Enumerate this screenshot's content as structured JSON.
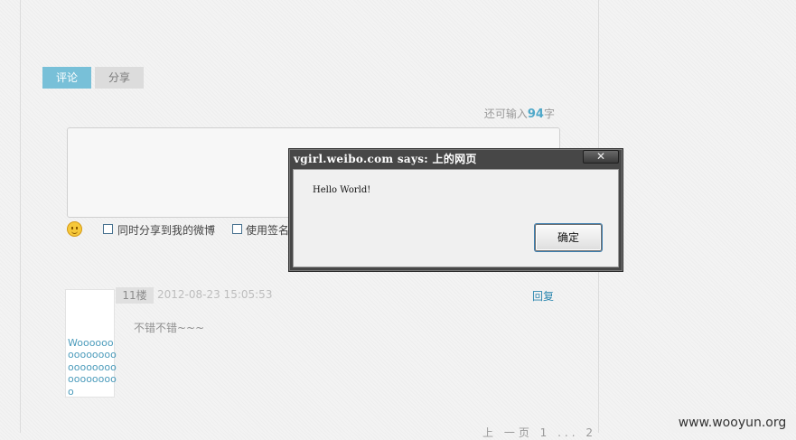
{
  "tabs": {
    "comment": "评论",
    "share": "分享"
  },
  "composer": {
    "remaining_prefix": "还可输入",
    "remaining_count": "94",
    "remaining_suffix": "字",
    "share_to_weibo_label": "同时分享到我的微博",
    "use_signature_label": "使用签名"
  },
  "comment": {
    "user": "Wooooooooooooooooooooooooooooooo",
    "floor": "11楼",
    "time": "2012-08-23 15:05:53",
    "reply_label": "回复",
    "content": "不错不错~~~"
  },
  "pager_text": "上 一页 1 ... 2",
  "watermark": "www.wooyun.org",
  "dialog": {
    "title": "vgirl.weibo.com says: 上的网页",
    "close_symbol": "✕",
    "message": "Hello World!",
    "ok_label": "确定"
  }
}
